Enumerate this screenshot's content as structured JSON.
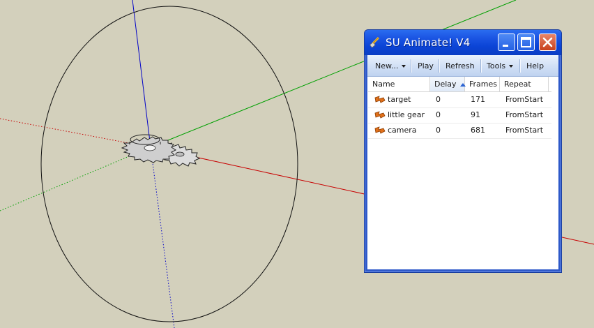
{
  "window": {
    "title": "SU Animate! V4",
    "icon": "brush-icon",
    "controls": [
      "minimize-icon",
      "maximize-icon",
      "close-icon"
    ]
  },
  "toolbar": {
    "new_label": "New...",
    "play_label": "Play",
    "refresh_label": "Refresh",
    "tools_label": "Tools",
    "help_label": "Help"
  },
  "table": {
    "columns": [
      "Name",
      "Delay",
      "Frames",
      "Repeat"
    ],
    "sorted_column": "Delay",
    "rows": [
      {
        "name": "target",
        "delay": "0",
        "frames": "171",
        "repeat": "FromStart"
      },
      {
        "name": "little gear",
        "delay": "0",
        "frames": "91",
        "repeat": "FromStart"
      },
      {
        "name": "camera",
        "delay": "0",
        "frames": "681",
        "repeat": "FromStart"
      }
    ]
  },
  "colors": {
    "viewport_background": "#d3d0bc",
    "titlebar": "#0b44d6",
    "axis_red": "#c80000",
    "axis_green": "#00a000",
    "axis_blue": "#0000c8"
  }
}
